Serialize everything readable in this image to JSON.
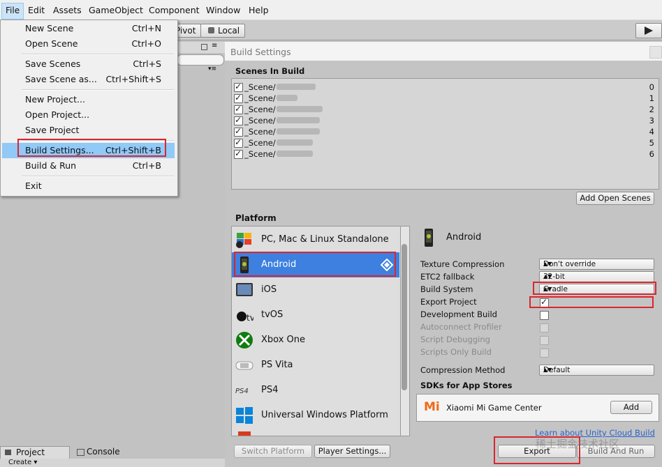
{
  "menubar": [
    "File",
    "Edit",
    "Assets",
    "GameObject",
    "Component",
    "Window",
    "Help"
  ],
  "toolbar": {
    "pivot": "Pivot",
    "local": "Local",
    "play_icon": "play-icon"
  },
  "file_menu": {
    "new_scene": {
      "label": "New Scene",
      "shortcut": "Ctrl+N"
    },
    "open_scene": {
      "label": "Open Scene",
      "shortcut": "Ctrl+O"
    },
    "save_scenes": {
      "label": "Save Scenes",
      "shortcut": "Ctrl+S"
    },
    "save_scene_as": {
      "label": "Save Scene as...",
      "shortcut": "Ctrl+Shift+S"
    },
    "new_project": {
      "label": "New Project...",
      "shortcut": ""
    },
    "open_project": {
      "label": "Open Project...",
      "shortcut": ""
    },
    "save_project": {
      "label": "Save Project",
      "shortcut": ""
    },
    "build_settings": {
      "label": "Build Settings...",
      "shortcut": "Ctrl+Shift+B"
    },
    "build_run": {
      "label": "Build & Run",
      "shortcut": "Ctrl+B"
    },
    "exit": {
      "label": "Exit",
      "shortcut": ""
    }
  },
  "build_settings": {
    "title": "Build Settings",
    "scenes_header": "Scenes In Build",
    "scenes": [
      {
        "name": "_Scene/",
        "index": "0"
      },
      {
        "name": "_Scene/",
        "index": "1"
      },
      {
        "name": "_Scene/",
        "index": "2"
      },
      {
        "name": "_Scene/",
        "index": "3"
      },
      {
        "name": "_Scene/",
        "index": "4"
      },
      {
        "name": "_Scene/",
        "index": "5"
      },
      {
        "name": "_Scene/",
        "index": "6"
      }
    ],
    "add_open_scenes": "Add Open Scenes",
    "platform_header": "Platform",
    "platforms": [
      "PC, Mac & Linux Standalone",
      "Android",
      "iOS",
      "tvOS",
      "Xbox One",
      "PS Vita",
      "PS4",
      "Universal Windows Platform"
    ],
    "selected_platform": "Android",
    "options": {
      "texture_compression": {
        "label": "Texture Compression",
        "value": "Don't override"
      },
      "etc2_fallback": {
        "label": "ETC2 fallback",
        "value": "32-bit"
      },
      "build_system": {
        "label": "Build System",
        "value": "Gradle"
      },
      "export_project": {
        "label": "Export Project",
        "checked": true
      },
      "development_build": {
        "label": "Development Build",
        "checked": false
      },
      "autoconnect_profiler": {
        "label": "Autoconnect Profiler",
        "checked": false
      },
      "script_debugging": {
        "label": "Script Debugging",
        "checked": false
      },
      "scripts_only_build": {
        "label": "Scripts Only Build",
        "checked": false
      },
      "compression_method": {
        "label": "Compression Method",
        "value": "Default"
      }
    },
    "sdks_header": "SDKs for App Stores",
    "sdk_name": "Xiaomi Mi Game Center",
    "sdk_add": "Add",
    "learn_link": "Learn about Unity Cloud Build",
    "switch_platform": "Switch Platform",
    "player_settings": "Player Settings...",
    "export": "Export",
    "build_and_run": "Build And Run",
    "watermark": "稀土掘金技术社区"
  },
  "bottom_tabs": {
    "project": "Project",
    "console": "Console",
    "create": "Create"
  },
  "colors": {
    "selection": "#3d80df",
    "highlight_box": "#d9262e",
    "menu_highlight": "#91c9f7",
    "link": "#2a62c9"
  }
}
